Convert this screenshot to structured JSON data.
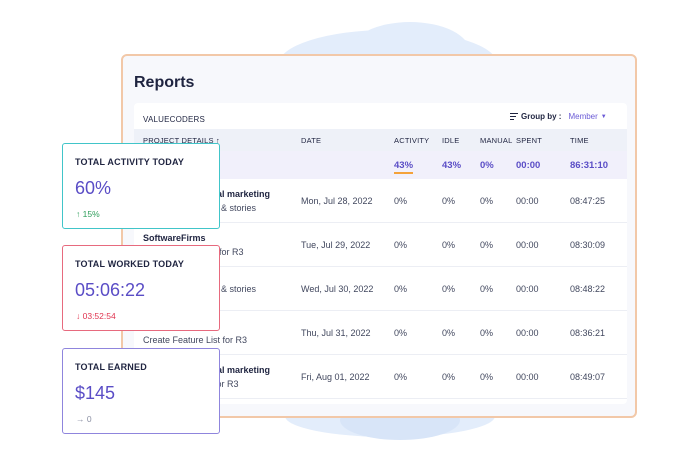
{
  "reports": {
    "title": "Reports",
    "company": "VALUECODERS",
    "group_by_label": "Group by :",
    "group_by_value": "Member",
    "columns": {
      "project": "PROJECT DETAILS ↑",
      "date": "DATE",
      "activity": "ACTIVITY",
      "idle": "IDLE",
      "manual": "MANUAL",
      "spent": "SPENT",
      "time": "TIME"
    },
    "summary": {
      "activity": "43%",
      "idle": "43%",
      "manual": "0%",
      "spent": "00:00",
      "time": "86:31:10"
    },
    "rows": [
      {
        "project_line1": "tal marketing",
        "project_line2": "s & stories",
        "date": "Mon, Jul 28, 2022",
        "activity": "0%",
        "idle": "0%",
        "manual": "0%",
        "spent": "00:00",
        "time": "08:47:25"
      },
      {
        "project_line1": "SoftwareFirms",
        "project_line2": "t for R3",
        "date": "Tue, Jul 29, 2022",
        "activity": "0%",
        "idle": "0%",
        "manual": "0%",
        "spent": "00:00",
        "time": "08:30:09"
      },
      {
        "project_line1": "",
        "project_line2": "s & stories",
        "date": "Wed, Jul 30, 2022",
        "activity": "0%",
        "idle": "0%",
        "manual": "0%",
        "spent": "00:00",
        "time": "08:48:22"
      },
      {
        "project_line1": "",
        "project_line2": "Create Feature List for R3",
        "date": "Thu, Jul 31, 2022",
        "activity": "0%",
        "idle": "0%",
        "manual": "0%",
        "spent": "00:00",
        "time": "08:36:21"
      },
      {
        "project_line1": "tal marketing",
        "project_line2": "for R3",
        "date": "Fri, Aug 01, 2022",
        "activity": "0%",
        "idle": "0%",
        "manual": "0%",
        "spent": "00:00",
        "time": "08:49:07"
      }
    ]
  },
  "cards": {
    "activity": {
      "label": "TOTAL ACTIVITY TODAY",
      "value": "60%",
      "delta": "↑ 15%"
    },
    "worked": {
      "label": "TOTAL WORKED TODAY",
      "value": "05:06:22",
      "delta": "↓ 03:52:54"
    },
    "earned": {
      "label": "TOTAL EARNED",
      "value": "$145",
      "delta": "→ 0"
    }
  },
  "colors": {
    "accent": "#5a4dc6",
    "activity_border": "#41c5c9",
    "worked_border": "#e76a7e",
    "earned_border": "#8f85dd",
    "panel_border": "#f2c8a8",
    "up": "#2e9e5b",
    "down": "#e0334f"
  }
}
